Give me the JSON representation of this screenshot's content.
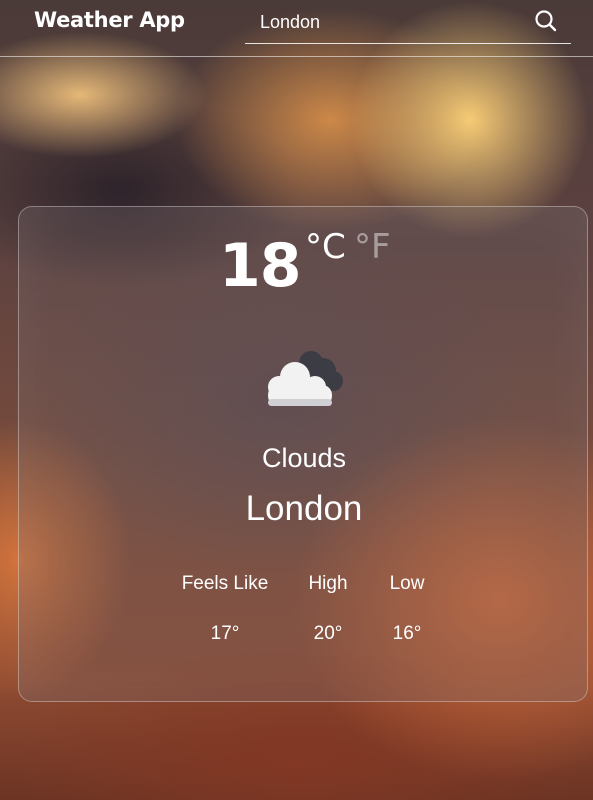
{
  "header": {
    "app_title": "Weather App",
    "search_value": "London",
    "search_icon": "search-icon"
  },
  "weather": {
    "temperature": "18",
    "unit_celsius": "°C",
    "unit_fahrenheit": "°F",
    "selected_unit": "C",
    "condition_icon": "clouds-icon",
    "condition": "Clouds",
    "city": "London"
  },
  "stats": {
    "feels_like_label": "Feels Like",
    "feels_like_value": "17°",
    "high_label": "High",
    "high_value": "20°",
    "low_label": "Low",
    "low_value": "16°"
  }
}
